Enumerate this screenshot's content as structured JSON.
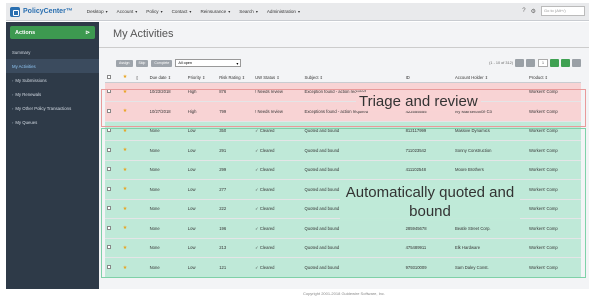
{
  "app": {
    "logo_text": "PolicyCenter™",
    "menus": [
      "Desktop",
      "Account",
      "Policy",
      "Contact",
      "Reinsurance",
      "Search",
      "Administration"
    ],
    "search_placeholder": "Go to (Alt+/)"
  },
  "sidebar": {
    "actions_label": "Actions",
    "items": [
      {
        "label": "Summary",
        "active": false
      },
      {
        "label": "My Activities",
        "active": true
      },
      {
        "label": "My Submissions",
        "active": false
      },
      {
        "label": "My Renewals",
        "active": false
      },
      {
        "label": "My Other Policy Transactions",
        "active": false
      },
      {
        "label": "My Queues",
        "active": false
      }
    ]
  },
  "main": {
    "title": "My Activities",
    "toolbar": {
      "btn1": "Assign",
      "btn2": "Skip",
      "btn3": "Complete",
      "filter": "All open"
    },
    "pager": {
      "text": "(1 - 10 of 312)",
      "page": "1"
    },
    "columns": [
      "",
      "",
      "",
      "Due date ⇕",
      "Priority ⇕",
      "Risk Rating ⇕",
      "UW Status ⇕",
      "Subject ⇕",
      "ID",
      "Account Holder ⇕",
      "Product ⇕"
    ],
    "rows": [
      {
        "due": "10/23/2018",
        "priority": "High",
        "risk": "876",
        "status": "Needs review",
        "subject": "Exception found - action required",
        "id": "",
        "holder": "",
        "product": "Workers' Comp",
        "group": "red"
      },
      {
        "due": "10/27/2018",
        "priority": "High",
        "risk": "799",
        "status": "Needs review",
        "subject": "Exceptions found - action required",
        "id": "422555555",
        "holder": "Ivy Maintenance Co",
        "product": "Workers' Comp",
        "group": "red"
      },
      {
        "due": "None",
        "priority": "Low",
        "risk": "350",
        "status": "Cleared",
        "subject": "Quoted and bound",
        "id": "812117999",
        "holder": "Massive Dynamics",
        "product": "Workers' Comp",
        "group": "green"
      },
      {
        "due": "None",
        "priority": "Low",
        "risk": "291",
        "status": "Cleared",
        "subject": "Quoted and bound",
        "id": "711023542",
        "holder": "Sonny Construction",
        "product": "Workers' Comp",
        "group": "green"
      },
      {
        "due": "None",
        "priority": "Low",
        "risk": "299",
        "status": "Cleared",
        "subject": "Quoted and bound",
        "id": "411102548",
        "holder": "Moore Brothers",
        "product": "Workers' Comp",
        "group": "green"
      },
      {
        "due": "None",
        "priority": "Low",
        "risk": "277",
        "status": "Cleared",
        "subject": "Quoted and bound",
        "id": "",
        "holder": "",
        "product": "Workers' Comp",
        "group": "green"
      },
      {
        "due": "None",
        "priority": "Low",
        "risk": "222",
        "status": "Cleared",
        "subject": "Quoted and bound",
        "id": "",
        "holder": "",
        "product": "Workers' Comp",
        "group": "green"
      },
      {
        "due": "None",
        "priority": "Low",
        "risk": "196",
        "status": "Cleared",
        "subject": "Quoted and bound",
        "id": "285945678",
        "holder": "Beatle Street Corp.",
        "product": "Workers' Comp",
        "group": "green"
      },
      {
        "due": "None",
        "priority": "Low",
        "risk": "213",
        "status": "Cleared",
        "subject": "Quoted and bound",
        "id": "475489911",
        "holder": "Elk Hardware",
        "product": "Workers' Comp",
        "group": "green"
      },
      {
        "due": "None",
        "priority": "Low",
        "risk": "121",
        "status": "Cleared",
        "subject": "Quoted and bound",
        "id": "979310009",
        "holder": "Sam Daley Const.",
        "product": "Workers' Comp",
        "group": "green"
      }
    ]
  },
  "annotations": {
    "triage": "Triage and review",
    "auto": "Automatically quoted and bound"
  },
  "footer": "Copyright 2001-2018 Guidewire Software, Inc."
}
